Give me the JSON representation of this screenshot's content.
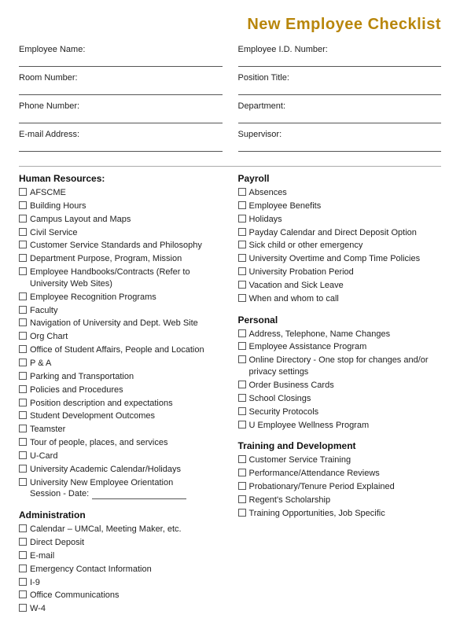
{
  "title": "New Employee Checklist",
  "form_fields": [
    {
      "label": "Employee Name:",
      "col": 0
    },
    {
      "label": "Employee I.D. Number:",
      "col": 1
    },
    {
      "label": "Room Number:",
      "col": 0
    },
    {
      "label": "Position Title:",
      "col": 1
    },
    {
      "label": "Phone Number:",
      "col": 0
    },
    {
      "label": "Department:",
      "col": 1
    },
    {
      "label": "E-mail Address:",
      "col": 0
    },
    {
      "label": "Supervisor:",
      "col": 1
    }
  ],
  "sections": {
    "left": [
      {
        "title": "Human Resources:",
        "items": [
          "AFSCME",
          "Building Hours",
          "Campus Layout and Maps",
          "Civil Service",
          "Customer Service Standards and Philosophy",
          "Department Purpose, Program, Mission",
          "Employee Handbooks/Contracts (Refer to University Web Sites)",
          "Employee Recognition Programs",
          "Faculty",
          "Navigation of University and Dept. Web Site",
          "Org Chart",
          "Office of Student Affairs, People and Location",
          "P & A",
          "Parking and Transportation",
          "Policies and Procedures",
          "Position description and expectations",
          "Student Development Outcomes",
          "Teamster",
          "Tour of people, places, and services",
          "U-Card",
          "University Academic Calendar/Holidays",
          "University New Employee Orientation"
        ],
        "session": true
      },
      {
        "title": "Administration",
        "items": [
          "Calendar – UMCal, Meeting Maker, etc.",
          "Direct Deposit",
          "E-mail",
          "Emergency Contact Information",
          "I-9",
          "Office Communications",
          "W-4"
        ]
      }
    ],
    "right": [
      {
        "title": "Payroll",
        "items": [
          "Absences",
          "Employee Benefits",
          "Holidays",
          "Payday Calendar and Direct Deposit Option",
          "Sick child or other emergency",
          "University Overtime and Comp Time Policies",
          "University Probation Period",
          "Vacation and Sick Leave",
          "When and whom to call"
        ]
      },
      {
        "title": "Personal",
        "items": [
          "Address, Telephone, Name Changes",
          "Employee Assistance Program",
          "Online Directory - One stop for changes and/or privacy settings",
          "Order Business Cards",
          "School Closings",
          "Security Protocols",
          "U Employee Wellness Program"
        ]
      },
      {
        "title": "Training and Development",
        "items": [
          "Customer Service Training",
          "Performance/Attendance Reviews",
          "Probationary/Tenure Period Explained",
          "Regent's Scholarship",
          "Training Opportunities, Job Specific"
        ]
      }
    ]
  }
}
